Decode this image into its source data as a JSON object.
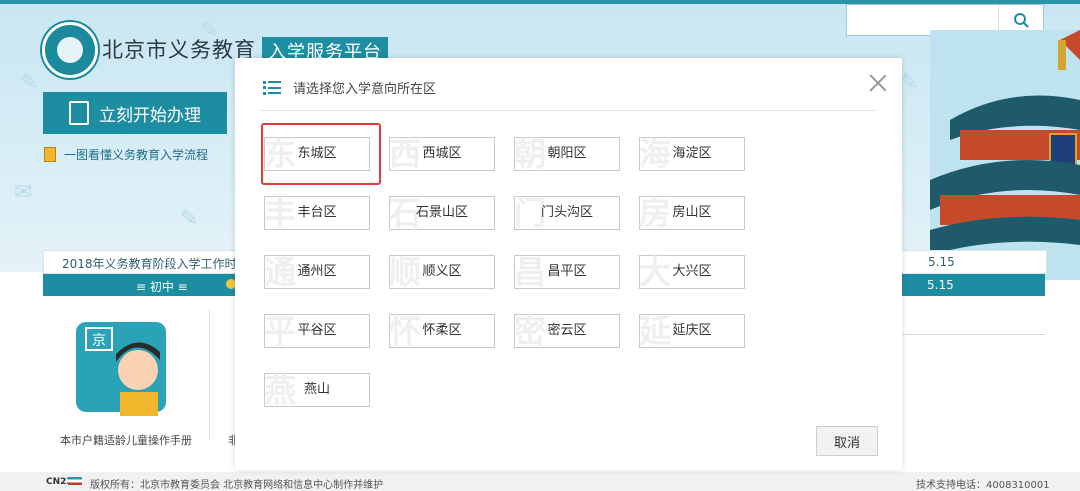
{
  "header": {
    "title": "北京市义务教育",
    "badge": "入学服务平台",
    "search_placeholder": ""
  },
  "left_panel": {
    "start_button": "立刻开始办理",
    "flow_link": "一图看懂义务教育入学流程",
    "notice": "2018年义务教育阶段入学工作时间",
    "tab_label": "≡ 初中 ≡",
    "manual_label": "本市户籍适龄儿童操作手册",
    "manual_label_partial": "非",
    "date_a": "5.15",
    "date_b": "5.15"
  },
  "modal": {
    "title": "请选择您入学意向所在区",
    "cancel": "取消",
    "districts": [
      {
        "label": "东城区",
        "ghost": "东"
      },
      {
        "label": "西城区",
        "ghost": "西"
      },
      {
        "label": "朝阳区",
        "ghost": "朝"
      },
      {
        "label": "海淀区",
        "ghost": "海"
      },
      {
        "label": "丰台区",
        "ghost": "丰"
      },
      {
        "label": "石景山区",
        "ghost": "石"
      },
      {
        "label": "门头沟区",
        "ghost": "门"
      },
      {
        "label": "房山区",
        "ghost": "房"
      },
      {
        "label": "通州区",
        "ghost": "通"
      },
      {
        "label": "顺义区",
        "ghost": "顺"
      },
      {
        "label": "昌平区",
        "ghost": "昌"
      },
      {
        "label": "大兴区",
        "ghost": "大"
      },
      {
        "label": "平谷区",
        "ghost": "平"
      },
      {
        "label": "怀柔区",
        "ghost": "怀"
      },
      {
        "label": "密云区",
        "ghost": "密"
      },
      {
        "label": "延庆区",
        "ghost": "延"
      },
      {
        "label": "燕山",
        "ghost": "燕"
      }
    ],
    "selected": "东城区"
  },
  "footer": {
    "logo_text": "CN22",
    "copyright": "版权所有：北京市教育委员会 北京教育网络和信息中心制作并维护",
    "support": "技术支持电话：4008310001"
  },
  "colors": {
    "primary": "#1d8ea1",
    "highlight": "#e03a3a"
  }
}
